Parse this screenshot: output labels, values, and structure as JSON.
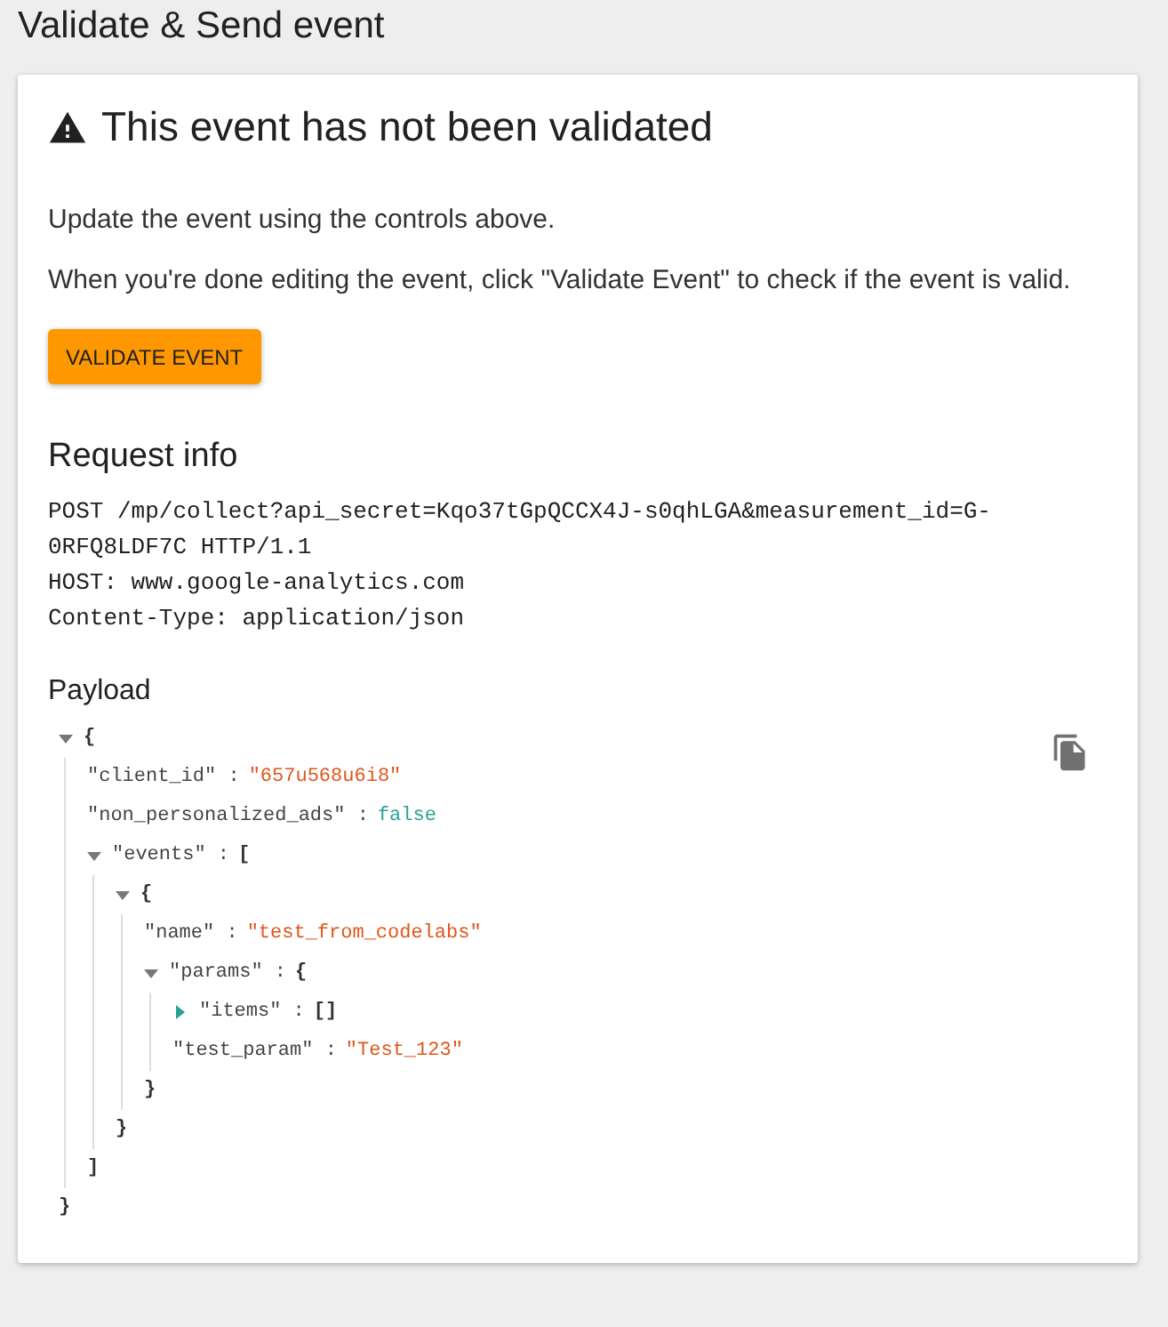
{
  "page_title": "Validate & Send event",
  "status": {
    "kind": "warning",
    "title": "This event has not been validated"
  },
  "instructions": [
    "Update the event using the controls above.",
    "When you're done editing the event, click \"Validate Event\" to check if the event is valid."
  ],
  "validate_button": "VALIDATE EVENT",
  "request_info": {
    "heading": "Request info",
    "lines": [
      "POST /mp/collect?api_secret=Kqo37tGpQCCX4J-s0qhLGA&measurement_id=G-0RFQ8LDF7C HTTP/1.1",
      "HOST: www.google-analytics.com",
      "Content-Type: application/json"
    ]
  },
  "payload": {
    "heading": "Payload",
    "tree": {
      "kind": "branch",
      "open": "{",
      "close": "}",
      "expanded": true,
      "children": [
        {
          "kind": "leaf",
          "key": "\"client_id\" :",
          "value": "\"657u568u6i8\"",
          "color": "#e0561b"
        },
        {
          "kind": "leaf",
          "key": "\"non_personalized_ads\" :",
          "value": "false",
          "color": "#2aa198"
        },
        {
          "kind": "branch",
          "key": "\"events\" :",
          "open": "[",
          "close": "]",
          "expanded": true,
          "children": [
            {
              "kind": "branch",
              "open": "{",
              "close": "}",
              "expanded": true,
              "children": [
                {
                  "kind": "leaf",
                  "key": "\"name\" :",
                  "value": "\"test_from_codelabs\"",
                  "color": "#e0561b"
                },
                {
                  "kind": "branch",
                  "key": "\"params\" :",
                  "open": "{",
                  "close": "}",
                  "expanded": true,
                  "children": [
                    {
                      "kind": "branch",
                      "key": "\"items\" :",
                      "open": "[]",
                      "expanded": false
                    },
                    {
                      "kind": "leaf",
                      "key": "\"test_param\" :",
                      "value": "\"Test_123\"",
                      "color": "#e0561b"
                    }
                  ]
                }
              ]
            }
          ]
        }
      ]
    }
  }
}
